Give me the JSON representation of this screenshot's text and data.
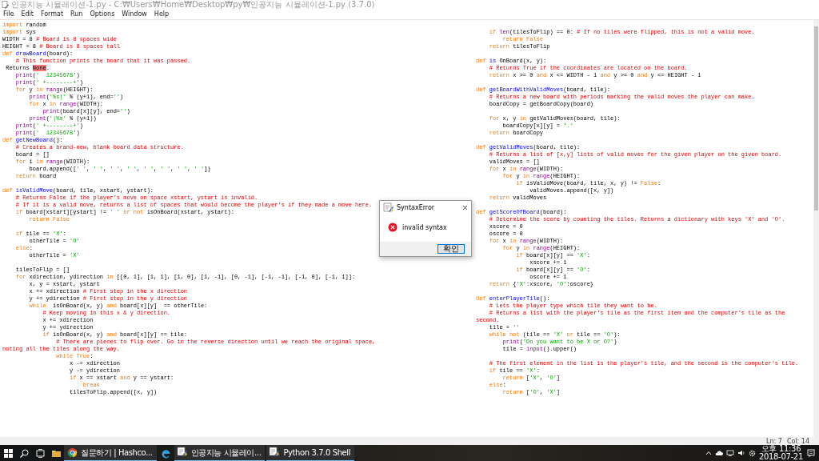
{
  "window": {
    "title": "인공지능 시뮬레이션-1.py - C:₩Users₩Home₩Desktop₩py₩인공지능 시뮬레이션-1.py (3.7.0)"
  },
  "menu": [
    "File",
    "Edit",
    "Format",
    "Run",
    "Options",
    "Window",
    "Help"
  ],
  "editor": {
    "lines": [
      {
        "kind": "code",
        "segments": [
          {
            "kind": "kw",
            "text": "import"
          },
          {
            "kind": "plain",
            "text": " random"
          }
        ]
      },
      {
        "kind": "code",
        "segments": [
          {
            "kind": "kw",
            "text": "import"
          },
          {
            "kind": "plain",
            "text": " sys"
          }
        ]
      },
      {
        "kind": "code",
        "segments": [
          {
            "kind": "plain",
            "text": "WIDTH = 8 "
          },
          {
            "kind": "com",
            "text": "# Board is 8 spaces wide"
          }
        ]
      },
      {
        "kind": "code",
        "segments": [
          {
            "kind": "plain",
            "text": "HEIGHT = 8 "
          },
          {
            "kind": "com",
            "text": "# Board is 8 spaces tall"
          }
        ]
      },
      {
        "kind": "code",
        "segments": [
          {
            "kind": "kw",
            "text": "def "
          },
          {
            "kind": "def",
            "text": "drawBoard"
          },
          {
            "kind": "plain",
            "text": "(board):"
          }
        ]
      },
      {
        "kind": "code",
        "segments": [
          {
            "kind": "com",
            "text": "    # This function prints the board that it was passed."
          }
        ]
      },
      {
        "kind": "code",
        "segments": [
          {
            "kind": "plain",
            "text": " Returns "
          },
          {
            "kind": "err",
            "text": "None"
          },
          {
            "kind": "plain",
            "text": "."
          }
        ]
      },
      {
        "kind": "code",
        "segments": [
          {
            "kind": "bi",
            "text": "    print"
          },
          {
            "kind": "plain",
            "text": "("
          },
          {
            "kind": "str",
            "text": "'  12345678'"
          },
          {
            "kind": "plain",
            "text": ")"
          }
        ]
      },
      {
        "kind": "code",
        "segments": [
          {
            "kind": "bi",
            "text": "    print"
          },
          {
            "kind": "plain",
            "text": "("
          },
          {
            "kind": "str",
            "text": "' +--------+'"
          },
          {
            "kind": "plain",
            "text": ")"
          }
        ]
      },
      {
        "kind": "code",
        "segments": [
          {
            "kind": "kw",
            "text": "    for"
          },
          {
            "kind": "plain",
            "text": " y "
          },
          {
            "kind": "kw",
            "text": "in "
          },
          {
            "kind": "bi",
            "text": "range"
          },
          {
            "kind": "plain",
            "text": "(HEIGHT):"
          }
        ]
      },
      {
        "kind": "code",
        "segments": [
          {
            "kind": "bi",
            "text": "        print"
          },
          {
            "kind": "plain",
            "text": "("
          },
          {
            "kind": "str",
            "text": "'%s|'"
          },
          {
            "kind": "plain",
            "text": " % (y+1), end="
          },
          {
            "kind": "str",
            "text": "''"
          },
          {
            "kind": "plain",
            "text": ")"
          }
        ]
      },
      {
        "kind": "code",
        "segments": [
          {
            "kind": "kw",
            "text": "        for"
          },
          {
            "kind": "plain",
            "text": " x "
          },
          {
            "kind": "kw",
            "text": "in "
          },
          {
            "kind": "bi",
            "text": "range"
          },
          {
            "kind": "plain",
            "text": "(WIDTH):"
          }
        ]
      },
      {
        "kind": "code",
        "segments": [
          {
            "kind": "bi",
            "text": "            print"
          },
          {
            "kind": "plain",
            "text": "(board[x][y], end="
          },
          {
            "kind": "str",
            "text": "''"
          },
          {
            "kind": "plain",
            "text": ")"
          }
        ]
      },
      {
        "kind": "code",
        "segments": [
          {
            "kind": "bi",
            "text": "        print"
          },
          {
            "kind": "plain",
            "text": "("
          },
          {
            "kind": "str",
            "text": "'|%s'"
          },
          {
            "kind": "plain",
            "text": " % (y+1))"
          }
        ]
      },
      {
        "kind": "code",
        "segments": [
          {
            "kind": "bi",
            "text": "    print"
          },
          {
            "kind": "plain",
            "text": "("
          },
          {
            "kind": "str",
            "text": "' +--------+'"
          },
          {
            "kind": "plain",
            "text": ")"
          }
        ]
      },
      {
        "kind": "code",
        "segments": [
          {
            "kind": "bi",
            "text": "    print"
          },
          {
            "kind": "plain",
            "text": "("
          },
          {
            "kind": "str",
            "text": "'  12345678'"
          },
          {
            "kind": "plain",
            "text": ")"
          }
        ]
      },
      {
        "kind": "code",
        "segments": [
          {
            "kind": "kw",
            "text": "def "
          },
          {
            "kind": "def",
            "text": "getNewBoard"
          },
          {
            "kind": "plain",
            "text": "():"
          }
        ]
      },
      {
        "kind": "code",
        "segments": [
          {
            "kind": "com",
            "text": "    # Creates a brand-new, blank board data structure."
          }
        ]
      },
      {
        "kind": "code",
        "segments": [
          {
            "kind": "plain",
            "text": "    board = []"
          }
        ]
      },
      {
        "kind": "code",
        "segments": [
          {
            "kind": "kw",
            "text": "    for"
          },
          {
            "kind": "plain",
            "text": " i "
          },
          {
            "kind": "kw",
            "text": "in "
          },
          {
            "kind": "bi",
            "text": "range"
          },
          {
            "kind": "plain",
            "text": "(WIDTH):"
          }
        ]
      },
      {
        "kind": "code",
        "segments": [
          {
            "kind": "plain",
            "text": "        board.append(["
          },
          {
            "kind": "str",
            "text": "' '"
          },
          {
            "kind": "plain",
            "text": ", "
          },
          {
            "kind": "str",
            "text": "' '"
          },
          {
            "kind": "plain",
            "text": ", "
          },
          {
            "kind": "str",
            "text": "' '"
          },
          {
            "kind": "plain",
            "text": ", "
          },
          {
            "kind": "str",
            "text": "' '"
          },
          {
            "kind": "plain",
            "text": ", "
          },
          {
            "kind": "str",
            "text": "' '"
          },
          {
            "kind": "plain",
            "text": ", "
          },
          {
            "kind": "str",
            "text": "' '"
          },
          {
            "kind": "plain",
            "text": ", "
          },
          {
            "kind": "str",
            "text": "' '"
          },
          {
            "kind": "plain",
            "text": ", "
          },
          {
            "kind": "str",
            "text": "' '"
          },
          {
            "kind": "plain",
            "text": "])"
          }
        ]
      },
      {
        "kind": "code",
        "segments": [
          {
            "kind": "kw",
            "text": "    return"
          },
          {
            "kind": "plain",
            "text": " board"
          }
        ]
      },
      {
        "kind": "blank"
      },
      {
        "kind": "code",
        "segments": [
          {
            "kind": "kw",
            "text": "def "
          },
          {
            "kind": "def",
            "text": "isValidMove"
          },
          {
            "kind": "plain",
            "text": "(board, tile, xstart, ystart):"
          }
        ]
      },
      {
        "kind": "code",
        "segments": [
          {
            "kind": "com",
            "text": "    # Returns False if the player's move on space xstart, ystart is invalid."
          }
        ]
      },
      {
        "kind": "code",
        "segments": [
          {
            "kind": "com",
            "text": "    # If it is a valid move, returns a list of spaces that would become the player's if they made a move here."
          }
        ]
      },
      {
        "kind": "code",
        "segments": [
          {
            "kind": "kw",
            "text": "    if"
          },
          {
            "kind": "plain",
            "text": " board[xstart][ystart] != "
          },
          {
            "kind": "str",
            "text": "' '"
          },
          {
            "kind": "kw",
            "text": " or not"
          },
          {
            "kind": "plain",
            "text": " isOnBoard(xstart, ystart):"
          }
        ]
      },
      {
        "kind": "code",
        "segments": [
          {
            "kind": "kw",
            "text": "        return False"
          }
        ]
      },
      {
        "kind": "blank"
      },
      {
        "kind": "code",
        "segments": [
          {
            "kind": "kw",
            "text": "    if"
          },
          {
            "kind": "plain",
            "text": " tile == "
          },
          {
            "kind": "str",
            "text": "'X'"
          },
          {
            "kind": "plain",
            "text": ":"
          }
        ]
      },
      {
        "kind": "code",
        "segments": [
          {
            "kind": "plain",
            "text": "        otherTile = "
          },
          {
            "kind": "str",
            "text": "'O'"
          }
        ]
      },
      {
        "kind": "code",
        "segments": [
          {
            "kind": "kw",
            "text": "    else"
          },
          {
            "kind": "plain",
            "text": ":"
          }
        ]
      },
      {
        "kind": "code",
        "segments": [
          {
            "kind": "plain",
            "text": "        otherTile = "
          },
          {
            "kind": "str",
            "text": "'X'"
          }
        ]
      },
      {
        "kind": "blank"
      },
      {
        "kind": "code",
        "segments": [
          {
            "kind": "plain",
            "text": "    tilesToFlip = []"
          }
        ]
      },
      {
        "kind": "code",
        "segments": [
          {
            "kind": "kw",
            "text": "    for"
          },
          {
            "kind": "plain",
            "text": " xdirection, ydirection "
          },
          {
            "kind": "kw",
            "text": "in"
          },
          {
            "kind": "plain",
            "text": " [[0, 1], [1, 1], [1, 0], [1, -1], [0, -1], [-1, -1], [-1, 0], [-1, 1]]:"
          }
        ]
      },
      {
        "kind": "code",
        "segments": [
          {
            "kind": "plain",
            "text": "        x, y = xstart, ystart"
          }
        ]
      },
      {
        "kind": "code",
        "segments": [
          {
            "kind": "plain",
            "text": "        x += xdirection "
          },
          {
            "kind": "com",
            "text": "# First step in the x direction"
          }
        ]
      },
      {
        "kind": "code",
        "segments": [
          {
            "kind": "plain",
            "text": "        y += ydirection "
          },
          {
            "kind": "com",
            "text": "# First step in the y direction"
          }
        ]
      },
      {
        "kind": "code",
        "segments": [
          {
            "kind": "kw",
            "text": "        while"
          },
          {
            "kind": "plain",
            "text": "  isOnBoard(x, y) "
          },
          {
            "kind": "kw",
            "text": "and"
          },
          {
            "kind": "plain",
            "text": " board[x][y]  == otherTile:"
          }
        ]
      },
      {
        "kind": "code",
        "segments": [
          {
            "kind": "com",
            "text": "            # Keep moving in this x & y direction."
          }
        ]
      },
      {
        "kind": "code",
        "segments": [
          {
            "kind": "plain",
            "text": "            x += xdirection"
          }
        ]
      },
      {
        "kind": "code",
        "segments": [
          {
            "kind": "plain",
            "text": "            y += ydirection"
          }
        ]
      },
      {
        "kind": "code",
        "segments": [
          {
            "kind": "kw",
            "text": "            if"
          },
          {
            "kind": "plain",
            "text": " isOnBoard(x, y) "
          },
          {
            "kind": "kw",
            "text": "and"
          },
          {
            "kind": "plain",
            "text": " board[x][y] == tile:"
          }
        ]
      },
      {
        "kind": "code",
        "segments": [
          {
            "kind": "com",
            "text": "                # There are pieces to flip over. Go in the reverse direction until we reach the original space, noting all the tiles along the way."
          }
        ]
      },
      {
        "kind": "code",
        "segments": [
          {
            "kind": "kw",
            "text": "                while True"
          },
          {
            "kind": "plain",
            "text": ":"
          }
        ]
      },
      {
        "kind": "code",
        "segments": [
          {
            "kind": "plain",
            "text": "                    x -= xdirection"
          }
        ]
      },
      {
        "kind": "code",
        "segments": [
          {
            "kind": "plain",
            "text": "                    y -= ydirection"
          }
        ]
      },
      {
        "kind": "code",
        "segments": [
          {
            "kind": "kw",
            "text": "                    if"
          },
          {
            "kind": "plain",
            "text": " x == xstart "
          },
          {
            "kind": "kw",
            "text": "and"
          },
          {
            "kind": "plain",
            "text": " y == ystart:"
          }
        ]
      },
      {
        "kind": "code",
        "segments": [
          {
            "kind": "kw",
            "text": "                        break"
          }
        ]
      },
      {
        "kind": "code",
        "segments": [
          {
            "kind": "plain",
            "text": "                    tilesToFlip.append([x, y])"
          }
        ]
      },
      {
        "kind": "blank"
      },
      {
        "kind": "code",
        "segments": [
          {
            "kind": "kw",
            "text": "    if "
          },
          {
            "kind": "bi",
            "text": "len"
          },
          {
            "kind": "plain",
            "text": "(tilesToFlip) == 0: "
          },
          {
            "kind": "com",
            "text": "# If no tiles were flipped, this is not a valid move."
          }
        ]
      },
      {
        "kind": "code",
        "segments": [
          {
            "kind": "kw",
            "text": "        return False"
          }
        ]
      },
      {
        "kind": "code",
        "segments": [
          {
            "kind": "kw",
            "text": "    return"
          },
          {
            "kind": "plain",
            "text": " tilesToFlip"
          }
        ]
      },
      {
        "kind": "blank"
      },
      {
        "kind": "code",
        "segments": [
          {
            "kind": "kw",
            "text": "def "
          },
          {
            "kind": "def",
            "text": "is"
          },
          {
            "kind": "plain",
            "text": " OnBoard(x, y):"
          }
        ]
      },
      {
        "kind": "code",
        "segments": [
          {
            "kind": "com",
            "text": "    # Returns True if the coordinates are located on the board."
          }
        ]
      },
      {
        "kind": "code",
        "segments": [
          {
            "kind": "kw",
            "text": "    return"
          },
          {
            "kind": "plain",
            "text": " x >= 0 "
          },
          {
            "kind": "kw",
            "text": "and"
          },
          {
            "kind": "plain",
            "text": " x <= WIDTH - 1 "
          },
          {
            "kind": "kw",
            "text": "and"
          },
          {
            "kind": "plain",
            "text": " y >= 0 "
          },
          {
            "kind": "kw",
            "text": "and"
          },
          {
            "kind": "plain",
            "text": " y <= HEIGHT - 1"
          }
        ]
      },
      {
        "kind": "blank"
      },
      {
        "kind": "code",
        "segments": [
          {
            "kind": "kw",
            "text": "def "
          },
          {
            "kind": "def",
            "text": "getBoardWithValidMoves"
          },
          {
            "kind": "plain",
            "text": "(board, tile):"
          }
        ]
      },
      {
        "kind": "code",
        "segments": [
          {
            "kind": "com",
            "text": "    # Returns a new board with periods marking the valid moves the player can make."
          }
        ]
      },
      {
        "kind": "code",
        "segments": [
          {
            "kind": "plain",
            "text": "    boardCopy = getBoardCopy(board)"
          }
        ]
      },
      {
        "kind": "blank"
      },
      {
        "kind": "code",
        "segments": [
          {
            "kind": "kw",
            "text": "    for"
          },
          {
            "kind": "plain",
            "text": " x, y "
          },
          {
            "kind": "kw",
            "text": "in"
          },
          {
            "kind": "plain",
            "text": " getValidMoves(board, tile):"
          }
        ]
      },
      {
        "kind": "code",
        "segments": [
          {
            "kind": "plain",
            "text": "        boardCopy[x][y] = "
          },
          {
            "kind": "str",
            "text": "'.'"
          }
        ]
      },
      {
        "kind": "code",
        "segments": [
          {
            "kind": "kw",
            "text": "    return"
          },
          {
            "kind": "plain",
            "text": " boardCopy"
          }
        ]
      },
      {
        "kind": "blank"
      },
      {
        "kind": "code",
        "segments": [
          {
            "kind": "kw",
            "text": "def "
          },
          {
            "kind": "def",
            "text": "getValidMoves"
          },
          {
            "kind": "plain",
            "text": "(board, tile):"
          }
        ]
      },
      {
        "kind": "code",
        "segments": [
          {
            "kind": "com",
            "text": "    # Returns a list of [x,y] lists of valid moves for the given player on the given board."
          }
        ]
      },
      {
        "kind": "code",
        "segments": [
          {
            "kind": "plain",
            "text": "    validMoves = []"
          }
        ]
      },
      {
        "kind": "code",
        "segments": [
          {
            "kind": "kw",
            "text": "    for"
          },
          {
            "kind": "plain",
            "text": " x "
          },
          {
            "kind": "kw",
            "text": "in "
          },
          {
            "kind": "bi",
            "text": "range"
          },
          {
            "kind": "plain",
            "text": "(WIDTH):"
          }
        ]
      },
      {
        "kind": "code",
        "segments": [
          {
            "kind": "kw",
            "text": "        for"
          },
          {
            "kind": "plain",
            "text": " y "
          },
          {
            "kind": "kw",
            "text": "in "
          },
          {
            "kind": "bi",
            "text": "range"
          },
          {
            "kind": "plain",
            "text": "(HEIGHT):"
          }
        ]
      },
      {
        "kind": "code",
        "segments": [
          {
            "kind": "kw",
            "text": "            if"
          },
          {
            "kind": "plain",
            "text": " isValidMove(board, tile, x, y) != "
          },
          {
            "kind": "kw",
            "text": "False"
          },
          {
            "kind": "plain",
            "text": ":"
          }
        ]
      },
      {
        "kind": "code",
        "segments": [
          {
            "kind": "plain",
            "text": "                validMoves.append([x, y])"
          }
        ]
      },
      {
        "kind": "code",
        "segments": [
          {
            "kind": "kw",
            "text": "    return"
          },
          {
            "kind": "plain",
            "text": " validMoves"
          }
        ]
      },
      {
        "kind": "blank"
      },
      {
        "kind": "code",
        "segments": [
          {
            "kind": "kw",
            "text": "def "
          },
          {
            "kind": "def",
            "text": "getScoreOfBoard"
          },
          {
            "kind": "plain",
            "text": "(board):"
          }
        ]
      },
      {
        "kind": "code",
        "segments": [
          {
            "kind": "com",
            "text": "    # Determine the score by counting the tiles. Returns a dictionary with keys 'X' and 'O'."
          }
        ]
      },
      {
        "kind": "code",
        "segments": [
          {
            "kind": "plain",
            "text": "    xscore = 0"
          }
        ]
      },
      {
        "kind": "code",
        "segments": [
          {
            "kind": "plain",
            "text": "    oscore = 0"
          }
        ]
      },
      {
        "kind": "code",
        "segments": [
          {
            "kind": "kw",
            "text": "    for"
          },
          {
            "kind": "plain",
            "text": " x "
          },
          {
            "kind": "kw",
            "text": "in "
          },
          {
            "kind": "bi",
            "text": "range"
          },
          {
            "kind": "plain",
            "text": "(WIDTH):"
          }
        ]
      },
      {
        "kind": "code",
        "segments": [
          {
            "kind": "kw",
            "text": "        for"
          },
          {
            "kind": "plain",
            "text": " y "
          },
          {
            "kind": "kw",
            "text": "in "
          },
          {
            "kind": "bi",
            "text": "range"
          },
          {
            "kind": "plain",
            "text": "(HEIGHT):"
          }
        ]
      },
      {
        "kind": "code",
        "segments": [
          {
            "kind": "kw",
            "text": "            if"
          },
          {
            "kind": "plain",
            "text": " board[x][y] == "
          },
          {
            "kind": "str",
            "text": "'X'"
          },
          {
            "kind": "plain",
            "text": ":"
          }
        ]
      },
      {
        "kind": "code",
        "segments": [
          {
            "kind": "plain",
            "text": "                xscore += 1"
          }
        ]
      },
      {
        "kind": "code",
        "segments": [
          {
            "kind": "kw",
            "text": "            if"
          },
          {
            "kind": "plain",
            "text": " board[x][y] == "
          },
          {
            "kind": "str",
            "text": "'O'"
          },
          {
            "kind": "plain",
            "text": ":"
          }
        ]
      },
      {
        "kind": "code",
        "segments": [
          {
            "kind": "plain",
            "text": "                oscore += 1"
          }
        ]
      },
      {
        "kind": "code",
        "segments": [
          {
            "kind": "kw",
            "text": "    return"
          },
          {
            "kind": "plain",
            "text": " {"
          },
          {
            "kind": "str",
            "text": "'X'"
          },
          {
            "kind": "plain",
            "text": ":xscore, "
          },
          {
            "kind": "str",
            "text": "'O'"
          },
          {
            "kind": "plain",
            "text": ":oscore}"
          }
        ]
      },
      {
        "kind": "blank"
      },
      {
        "kind": "code",
        "segments": [
          {
            "kind": "kw",
            "text": "def "
          },
          {
            "kind": "def",
            "text": "enterPlayerTile"
          },
          {
            "kind": "plain",
            "text": "():"
          }
        ]
      },
      {
        "kind": "code",
        "segments": [
          {
            "kind": "com",
            "text": "    # Lets the player type which tile they want to be."
          }
        ]
      },
      {
        "kind": "code",
        "segments": [
          {
            "kind": "com",
            "text": "    # Returns a list with the player's tile as the first item and the computer's tile as the second."
          }
        ]
      },
      {
        "kind": "code",
        "segments": [
          {
            "kind": "plain",
            "text": "    tile = "
          },
          {
            "kind": "str",
            "text": "''"
          }
        ]
      },
      {
        "kind": "code",
        "segments": [
          {
            "kind": "kw",
            "text": "    while not"
          },
          {
            "kind": "plain",
            "text": " (tile == "
          },
          {
            "kind": "str",
            "text": "'X'"
          },
          {
            "kind": "kw",
            "text": " or"
          },
          {
            "kind": "plain",
            "text": " tile == "
          },
          {
            "kind": "str",
            "text": "'O'"
          },
          {
            "kind": "plain",
            "text": "):"
          }
        ]
      },
      {
        "kind": "code",
        "segments": [
          {
            "kind": "bi",
            "text": "        print"
          },
          {
            "kind": "plain",
            "text": "("
          },
          {
            "kind": "str",
            "text": "'Do you want to be X or O?'"
          },
          {
            "kind": "plain",
            "text": ")"
          }
        ]
      },
      {
        "kind": "code",
        "segments": [
          {
            "kind": "plain",
            "text": "        tile = "
          },
          {
            "kind": "bi",
            "text": "input"
          },
          {
            "kind": "plain",
            "text": "().upper()"
          }
        ]
      },
      {
        "kind": "blank"
      },
      {
        "kind": "code",
        "segments": [
          {
            "kind": "com",
            "text": "    # The first element in the list is the player's tile, and the second is the computer's tile."
          }
        ]
      },
      {
        "kind": "code",
        "segments": [
          {
            "kind": "kw",
            "text": "    if"
          },
          {
            "kind": "plain",
            "text": " tile == "
          },
          {
            "kind": "str",
            "text": "'X'"
          },
          {
            "kind": "plain",
            "text": ":"
          }
        ]
      },
      {
        "kind": "code",
        "segments": [
          {
            "kind": "kw",
            "text": "        return"
          },
          {
            "kind": "plain",
            "text": " ["
          },
          {
            "kind": "str",
            "text": "'X'"
          },
          {
            "kind": "plain",
            "text": ", "
          },
          {
            "kind": "str",
            "text": "'O'"
          },
          {
            "kind": "plain",
            "text": "]"
          }
        ]
      },
      {
        "kind": "code",
        "segments": [
          {
            "kind": "kw",
            "text": "    else"
          },
          {
            "kind": "plain",
            "text": ":"
          }
        ]
      },
      {
        "kind": "code",
        "segments": [
          {
            "kind": "kw",
            "text": "        return"
          },
          {
            "kind": "plain",
            "text": " ["
          },
          {
            "kind": "str",
            "text": "'O'"
          },
          {
            "kind": "plain",
            "text": ", "
          },
          {
            "kind": "str",
            "text": "'X'"
          },
          {
            "kind": "plain",
            "text": "]"
          }
        ]
      }
    ]
  },
  "status_bar": {
    "line": "Ln: 7",
    "column": "Col: 14"
  },
  "dialog": {
    "title": "SyntaxError",
    "message": "invalid syntax",
    "button": "확인"
  },
  "taskbar": {
    "apps": [
      {
        "kind": "start"
      },
      {
        "kind": "search"
      },
      {
        "kind": "taskview"
      },
      {
        "kind": "folder"
      },
      {
        "kind": "browser",
        "label": "질문하기 | Hashco..."
      },
      {
        "kind": "edge"
      },
      {
        "kind": "idle",
        "label": "인공지능 시뮬레이..."
      },
      {
        "kind": "idle",
        "label": "Python 3.7.0 Shell"
      }
    ],
    "time": "오후 11:36",
    "date": "2018-07-21"
  }
}
